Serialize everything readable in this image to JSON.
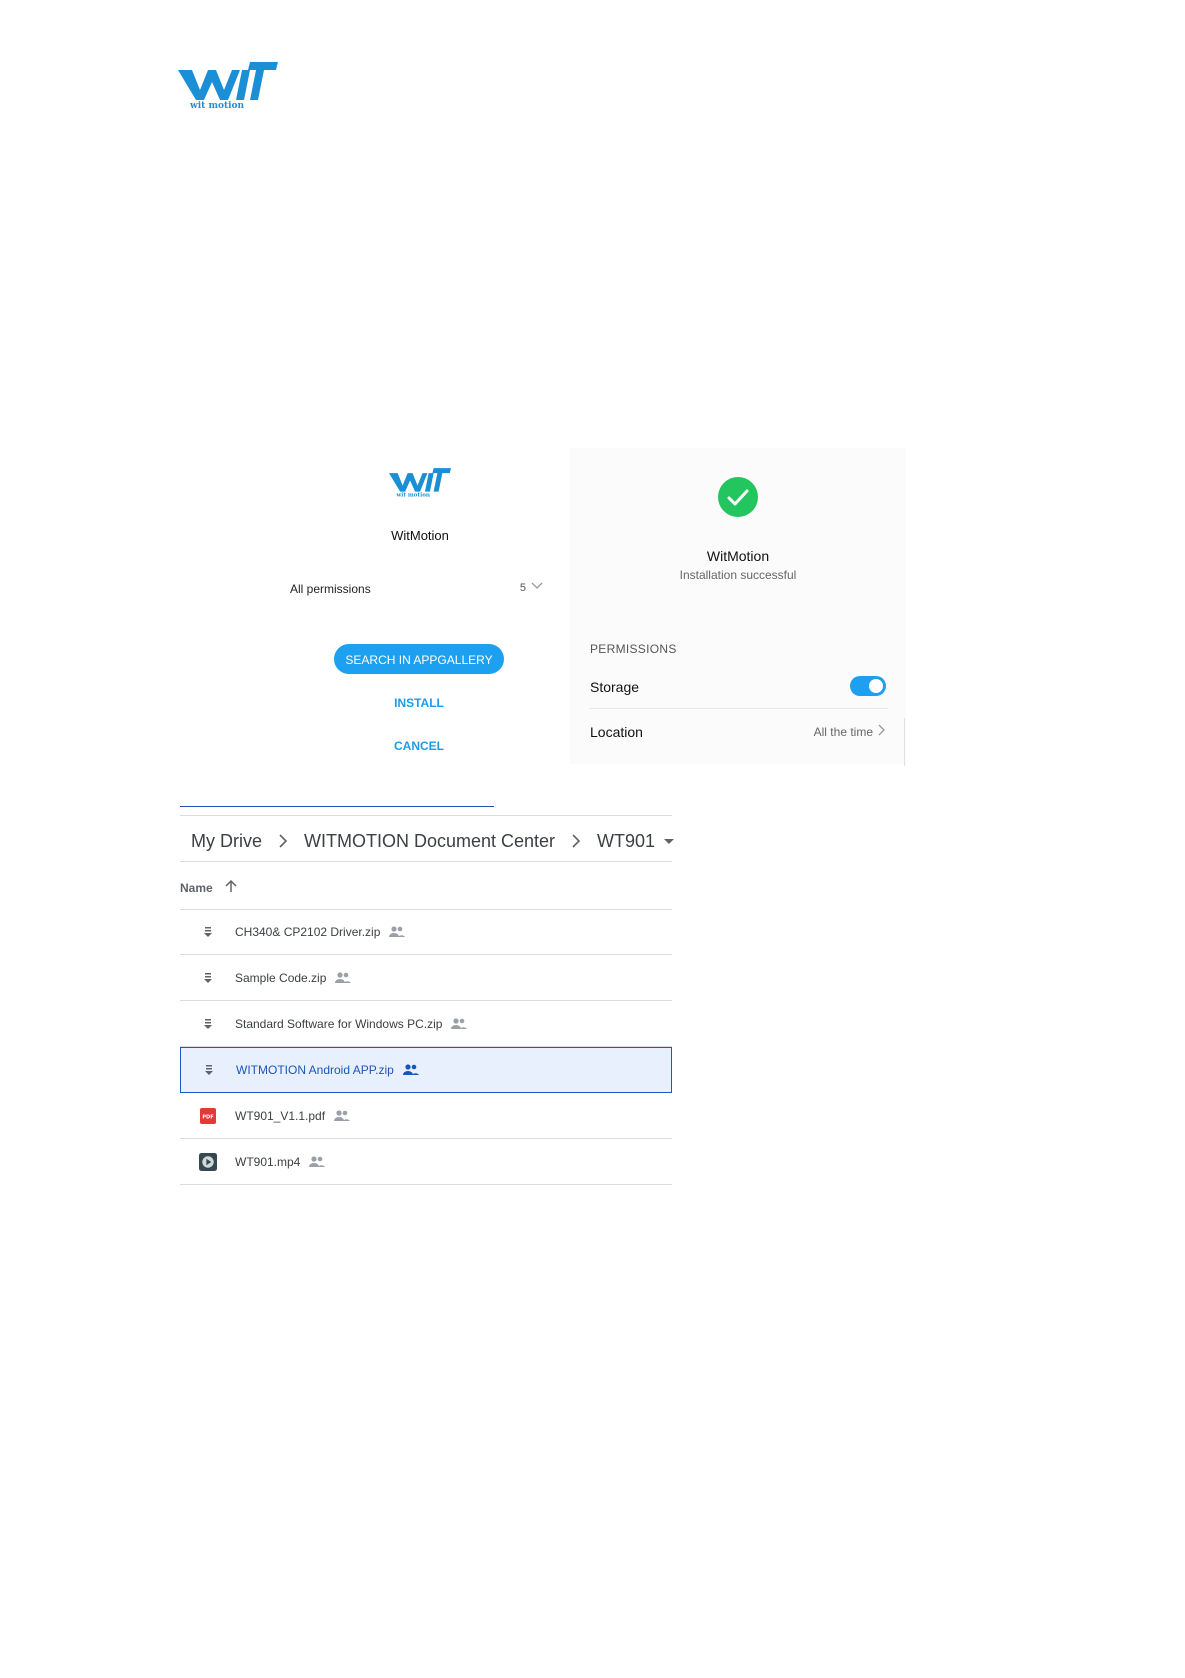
{
  "header": {
    "logo_text": "wit motion"
  },
  "install_dialog": {
    "logo_text": "wit motion",
    "app_name": "WitMotion",
    "permissions_label": "All permissions",
    "permissions_count": "5",
    "search_button": "SEARCH IN APPGALLERY",
    "install_button": "INSTALL",
    "cancel_button": "CANCEL"
  },
  "success_screen": {
    "app_name": "WitMotion",
    "status": "Installation successful",
    "permissions_header": "PERMISSIONS",
    "storage_label": "Storage",
    "storage_enabled": true,
    "location_label": "Location",
    "location_value": "All the time"
  },
  "drive": {
    "breadcrumb": [
      "My Drive",
      "WITMOTION Document Center",
      "WT901"
    ],
    "column_name": "Name",
    "files": [
      {
        "name": "CH340& CP2102 Driver.zip",
        "icon": "zip-icon",
        "selected": false
      },
      {
        "name": "Sample Code.zip",
        "icon": "zip-icon",
        "selected": false
      },
      {
        "name": "Standard Software for Windows PC.zip",
        "icon": "zip-icon",
        "selected": false
      },
      {
        "name": "WITMOTION Android APP.zip",
        "icon": "zip-icon",
        "selected": true
      },
      {
        "name": "WT901_V1.1.pdf",
        "icon": "pdf-icon",
        "selected": false
      },
      {
        "name": "WT901.mp4",
        "icon": "video-icon",
        "selected": false
      }
    ]
  },
  "colors": {
    "accent": "#1ea0f0",
    "success": "#22c55e",
    "selection": "#e8f0fe",
    "selection_border": "#1a57c7"
  }
}
